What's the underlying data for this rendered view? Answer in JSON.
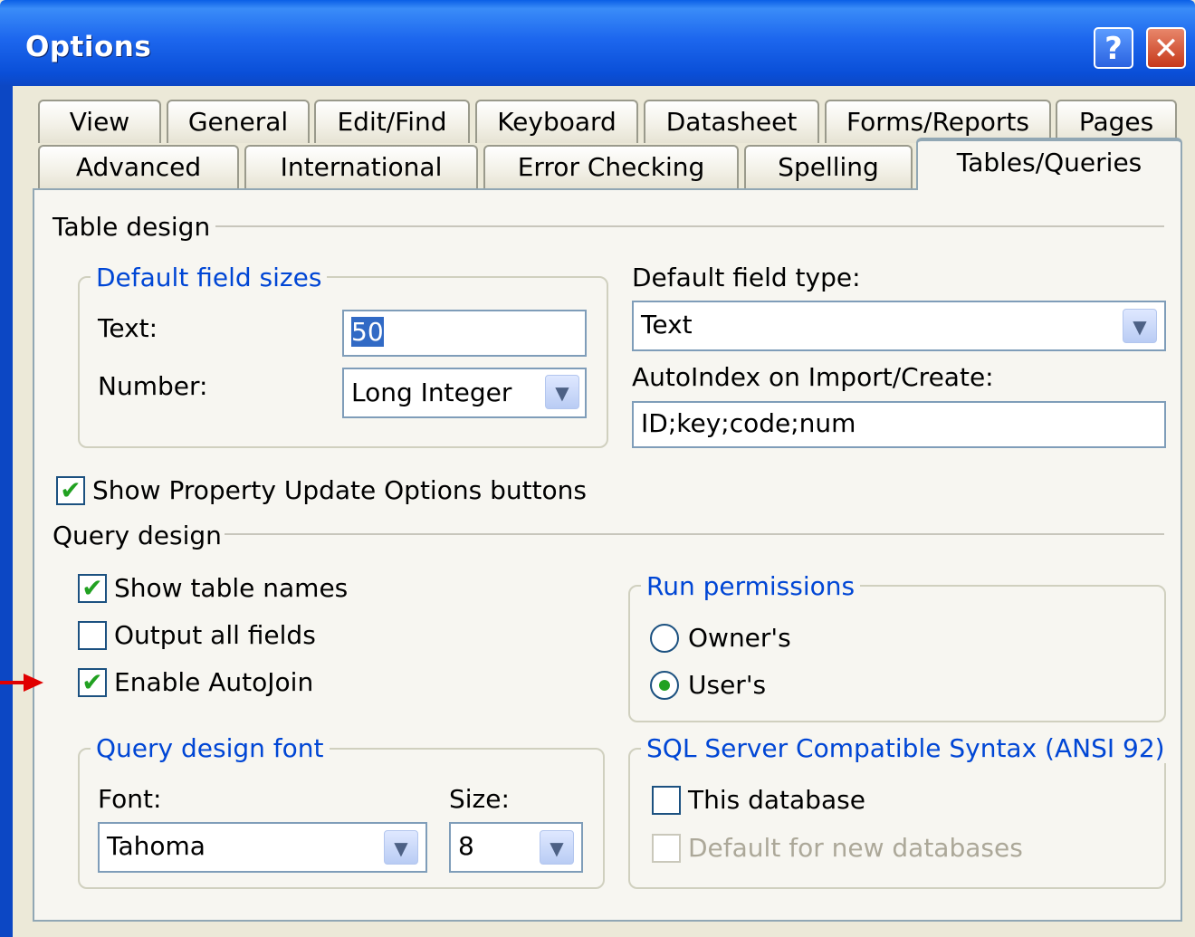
{
  "window": {
    "title": "Options",
    "help_label": "?",
    "close_label": "✕"
  },
  "tabs_row1": [
    "View",
    "General",
    "Edit/Find",
    "Keyboard",
    "Datasheet",
    "Forms/Reports",
    "Pages"
  ],
  "tabs_row2": [
    "Advanced",
    "International",
    "Error Checking",
    "Spelling",
    "Tables/Queries"
  ],
  "active_tab": "Tables/Queries",
  "table_design": {
    "heading": "Table design",
    "field_sizes": {
      "legend": "Default field sizes",
      "text_label": "Text:",
      "text_value": "50",
      "number_label": "Number:",
      "number_value": "Long Integer"
    },
    "default_field_type_label": "Default field type:",
    "default_field_type_value": "Text",
    "autoindex_label": "AutoIndex on Import/Create:",
    "autoindex_value": "ID;key;code;num",
    "show_property_update": {
      "label": "Show Property Update Options buttons",
      "checked": true
    }
  },
  "query_design": {
    "heading": "Query design",
    "show_table_names": {
      "label": "Show table names",
      "checked": true
    },
    "output_all_fields": {
      "label": "Output all fields",
      "checked": false
    },
    "enable_autojoin": {
      "label": "Enable AutoJoin",
      "checked": true
    },
    "run_permissions": {
      "legend": "Run permissions",
      "owners": {
        "label": "Owner's",
        "selected": false
      },
      "users": {
        "label": "User's",
        "selected": true
      }
    },
    "font_group": {
      "legend": "Query design font",
      "font_label": "Font:",
      "font_value": "Tahoma",
      "size_label": "Size:",
      "size_value": "8"
    },
    "sql_syntax": {
      "legend": "SQL Server Compatible Syntax (ANSI 92)",
      "this_database": {
        "label": "This database",
        "checked": false
      },
      "default_new": {
        "label": "Default for new databases",
        "checked": false,
        "disabled": true
      }
    }
  },
  "glyphs": {
    "check": "✔",
    "dropdown": "▼"
  },
  "colors": {
    "accent_blue": "#0046D5",
    "check_green": "#21A121",
    "annotation_red": "#E00000",
    "active_tab_highlight": "#F5B23A"
  }
}
